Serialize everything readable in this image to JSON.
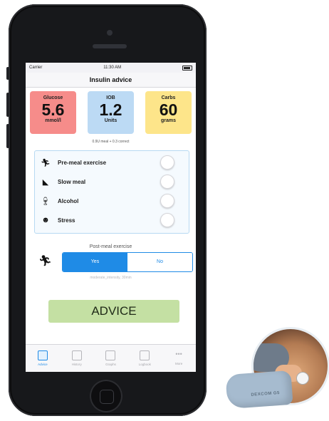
{
  "status_bar": {
    "carrier": "Carrier",
    "time": "11:30 AM"
  },
  "nav": {
    "title": "Insulin advice"
  },
  "tiles": [
    {
      "label": "Glucose",
      "value": "5.6",
      "unit": "mmol/l",
      "color": "#f68c8a"
    },
    {
      "label": "IOB",
      "value": "1.2",
      "unit": "Units",
      "color": "#bcdaf4"
    },
    {
      "label": "Carbs",
      "value": "60",
      "unit": "grams",
      "color": "#fde58a"
    }
  ],
  "iob_note": "0.9U meal + 0.3 correct",
  "options": [
    {
      "label": "Pre-meal exercise",
      "icon": "exercise-icon"
    },
    {
      "label": "Slow meal",
      "icon": "pizza-icon"
    },
    {
      "label": "Alcohol",
      "icon": "wine-glass-icon"
    },
    {
      "label": "Stress",
      "icon": "stressed-face-icon"
    }
  ],
  "post_meal": {
    "label": "Post-meal exercise",
    "yes": "Yes",
    "no": "No",
    "selected": "Yes",
    "note": "moderate_intensity, 30min"
  },
  "advice_button": "ADVICE",
  "tabs": [
    {
      "label": "Advice",
      "icon": "advice-icon",
      "active": true
    },
    {
      "label": "History",
      "icon": "history-icon",
      "active": false
    },
    {
      "label": "Graphs",
      "icon": "graphs-icon",
      "active": false
    },
    {
      "label": "Logbook",
      "icon": "logbook-icon",
      "active": false
    },
    {
      "label": "More",
      "icon": "more-icon",
      "active": false
    }
  ],
  "device_label": "DEXCOM G5",
  "colors": {
    "accent": "#1f8be6",
    "advice": "#c4e0a3"
  }
}
